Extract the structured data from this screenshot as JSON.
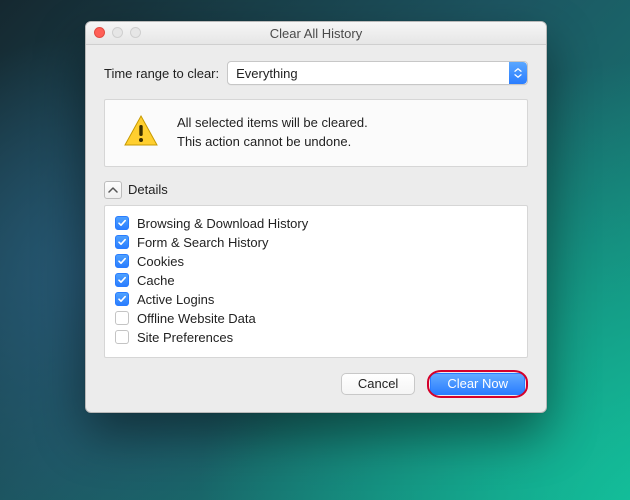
{
  "window": {
    "title": "Clear All History"
  },
  "range": {
    "label": "Time range to clear:",
    "value": "Everything"
  },
  "warning": {
    "line1": "All selected items will be cleared.",
    "line2": "This action cannot be undone."
  },
  "details": {
    "label": "Details",
    "items": [
      {
        "label": "Browsing & Download History",
        "checked": true
      },
      {
        "label": "Form & Search History",
        "checked": true
      },
      {
        "label": "Cookies",
        "checked": true
      },
      {
        "label": "Cache",
        "checked": true
      },
      {
        "label": "Active Logins",
        "checked": true
      },
      {
        "label": "Offline Website Data",
        "checked": false
      },
      {
        "label": "Site Preferences",
        "checked": false
      }
    ]
  },
  "buttons": {
    "cancel": "Cancel",
    "clear": "Clear Now"
  }
}
